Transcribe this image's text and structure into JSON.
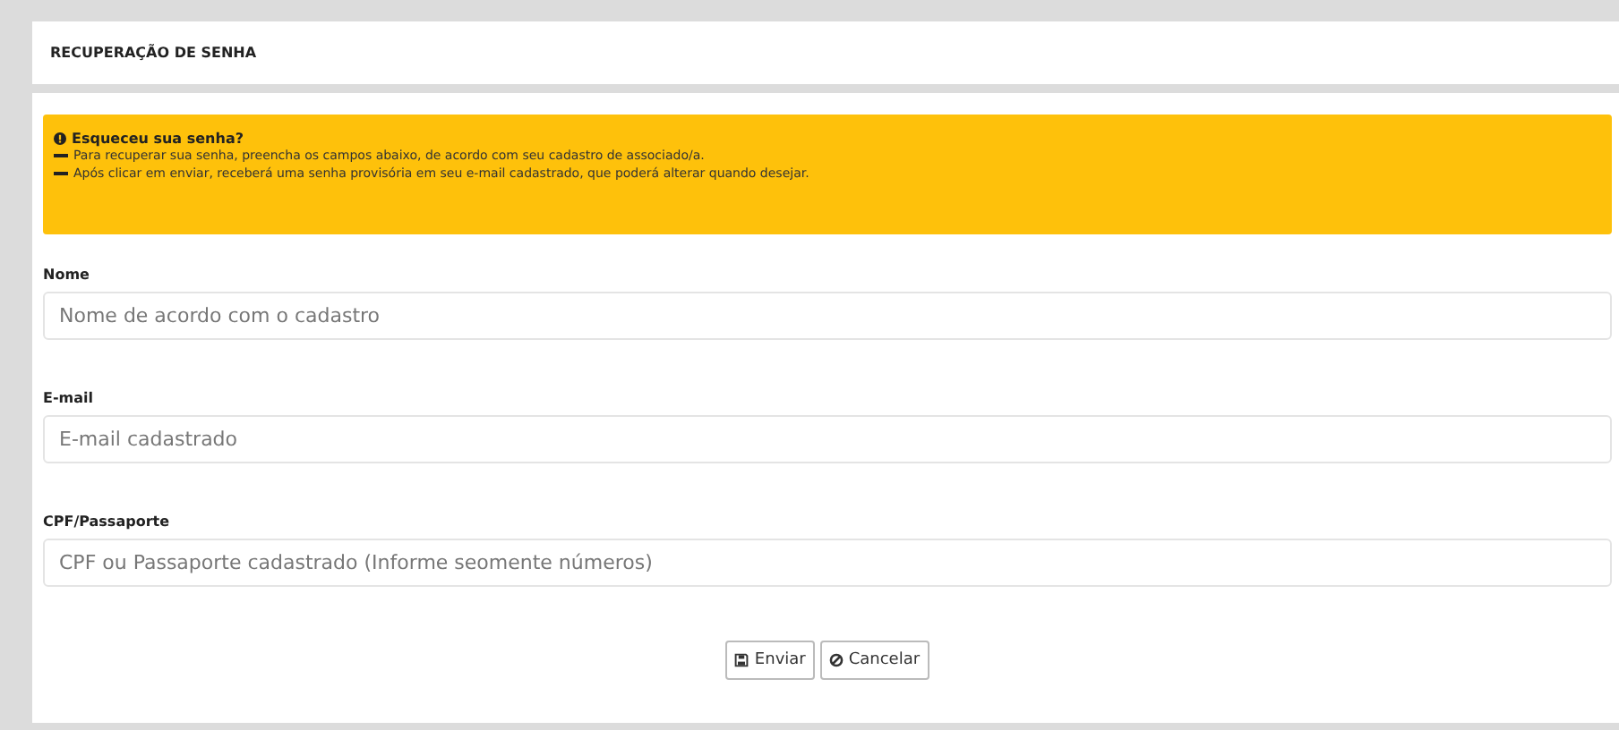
{
  "header": {
    "title": "RECUPERAÇÃO DE SENHA"
  },
  "alert": {
    "title": "Esqueceu sua senha?",
    "items": [
      "Para recuperar sua senha, preencha os campos abaixo, de acordo com seu cadastro de associado/a.",
      "Após clicar em enviar, receberá uma senha provisória em seu e-mail cadastrado, que poderá alterar quando desejar."
    ]
  },
  "fields": [
    {
      "label": "Nome",
      "placeholder": "Nome de acordo com o cadastro"
    },
    {
      "label": "E-mail",
      "placeholder": "E-mail cadastrado"
    },
    {
      "label": "CPF/Passaporte",
      "placeholder": "CPF ou Passaporte cadastrado (Informe seomente números)"
    }
  ],
  "buttons": [
    {
      "kind": "submit",
      "label": "Enviar"
    },
    {
      "kind": "cancel",
      "label": "Cancelar"
    }
  ]
}
